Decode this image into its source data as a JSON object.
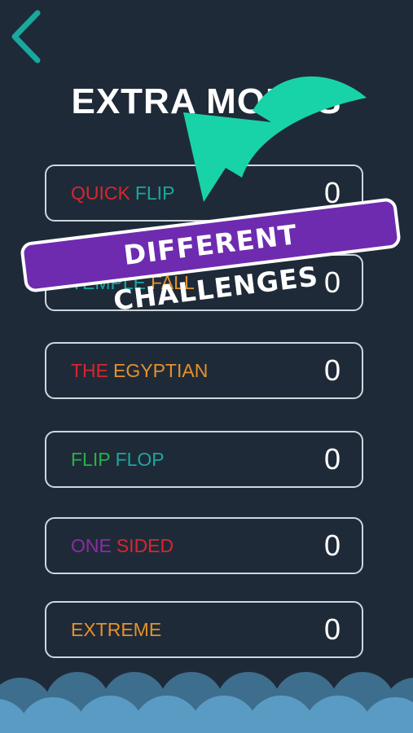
{
  "header": {
    "back_icon": "chevron-left-icon",
    "title": "EXTRA MODES"
  },
  "modes": [
    {
      "words": [
        {
          "text": "QUICK",
          "color": "#d8262f"
        },
        {
          "text": "FLIP",
          "color": "#19a89e"
        }
      ],
      "score": "0"
    },
    {
      "words": [
        {
          "text": "TEMPLE",
          "color": "#19a89e"
        },
        {
          "text": "FALL",
          "color": "#e5912a"
        }
      ],
      "score": "0"
    },
    {
      "words": [
        {
          "text": "THE",
          "color": "#d8262f"
        },
        {
          "text": "EGYPTIAN",
          "color": "#e5912a"
        }
      ],
      "score": "0"
    },
    {
      "words": [
        {
          "text": "FLIP",
          "color": "#26b24a"
        },
        {
          "text": "FLOP",
          "color": "#19a89e"
        }
      ],
      "score": "0"
    },
    {
      "words": [
        {
          "text": "ONE",
          "color": "#8e2aa6"
        },
        {
          "text": "SIDED",
          "color": "#d8262f"
        }
      ],
      "score": "0"
    },
    {
      "words": [
        {
          "text": "EXTREME",
          "color": "#e5912a"
        }
      ],
      "score": "0"
    }
  ],
  "promo": {
    "banner_text": "DIFFERENT CHALLENGES",
    "arrow_icon": "curved-arrow-icon"
  },
  "colors": {
    "background": "#1f2a38",
    "accent": "#19d3a8",
    "banner": "#6e2bb0",
    "wave_dark": "#3d6e8d",
    "wave_light": "#5a9bc3"
  }
}
